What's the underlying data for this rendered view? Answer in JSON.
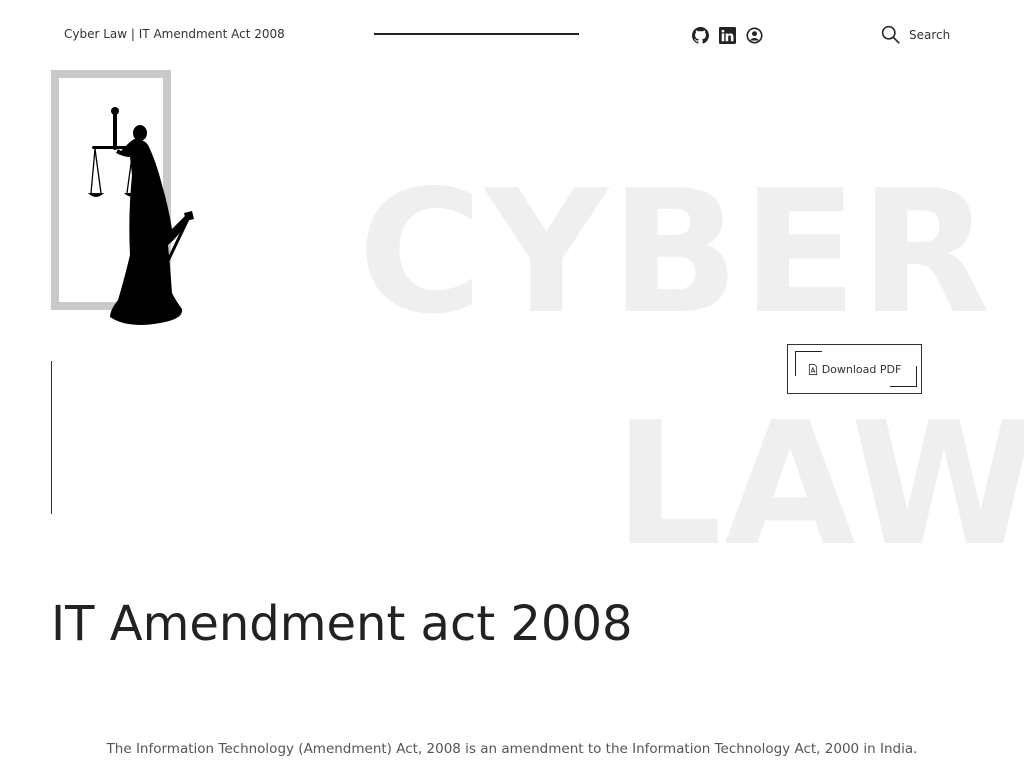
{
  "header": {
    "site_title": "Cyber Law | IT Amendment Act 2008",
    "search_label": "Search",
    "icons": {
      "github": "github-icon",
      "linkedin": "linkedin-icon",
      "profile": "user-circle-icon",
      "search": "search-icon"
    }
  },
  "hero": {
    "word_1": "CYBER",
    "word_2": "LAW",
    "download_label": "Download PDF",
    "download_icon": "pdf-file-icon",
    "logo": "lady-justice-logo"
  },
  "main": {
    "title": "IT Amendment act 2008",
    "intro": "The Information Technology (Amendment) Act, 2008 is an amendment to the Information Technology Act, 2000 in India."
  },
  "colors": {
    "text": "#222222",
    "hero_watermark": "#efefef",
    "frame": "#c9c9c9"
  }
}
